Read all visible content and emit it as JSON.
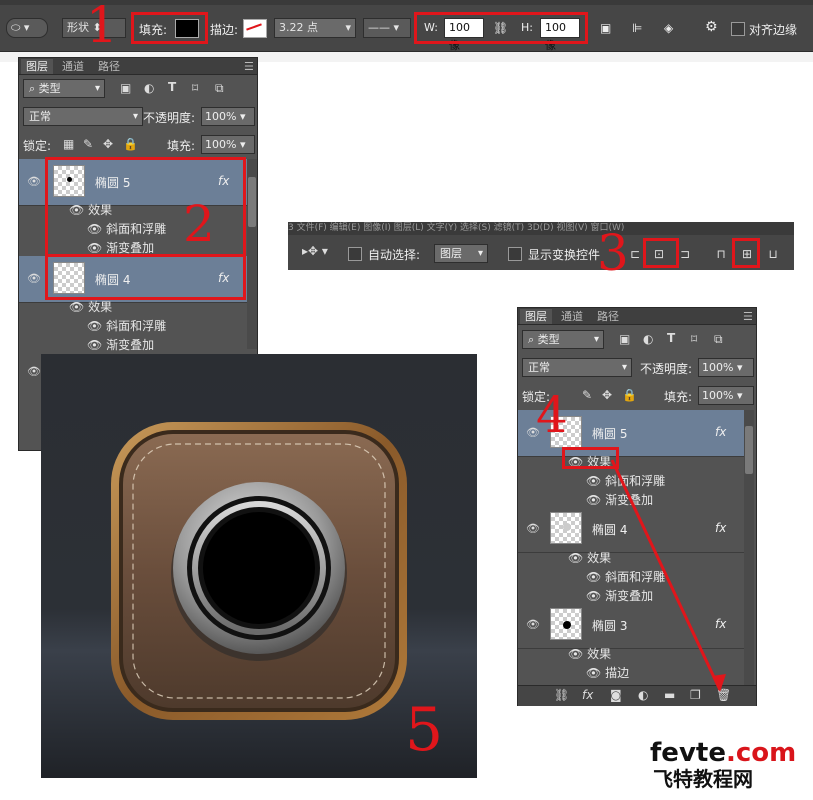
{
  "options_bar": {
    "shape_mode": "形状",
    "fill_label": "填充:",
    "stroke_label": "描边:",
    "stroke_width": "3.22 点",
    "w_label": "W:",
    "w_value": "100 像",
    "h_label": "H:",
    "h_value": "100 像",
    "align_edges_label": "对齐边缘"
  },
  "annotations": [
    "1",
    "2",
    "3",
    "4",
    "5"
  ],
  "panel_a": {
    "tabs": [
      "图层",
      "通道",
      "路径"
    ],
    "filter_kind": "类型",
    "blend_mode": "正常",
    "opacity_label": "不透明度:",
    "opacity_value": "100%",
    "lock_label": "锁定:",
    "fill_label": "填充:",
    "fill_value": "100%",
    "layers": [
      {
        "name": "椭圆 5",
        "effects_label": "效果",
        "effects": [
          "斜面和浮雕",
          "渐变叠加"
        ],
        "fx": "fx"
      },
      {
        "name": "椭圆 4",
        "effects_label": "效果",
        "effects": [
          "斜面和浮雕",
          "渐变叠加"
        ],
        "fx": "fx"
      }
    ]
  },
  "move_toolbar": {
    "auto_select_label": "自动选择:",
    "auto_select_value": "图层",
    "show_transform_label": "显示变换控件",
    "menu_fragment": "3 文件(F) 编辑(E) 图像(I) 图层(L) 文字(Y) 选择(S) 滤镜(T) 3D(D) 视图(V) 窗口(W)"
  },
  "panel_b": {
    "tabs": [
      "图层",
      "通道",
      "路径"
    ],
    "filter_kind": "类型",
    "blend_mode": "正常",
    "opacity_label": "不透明度:",
    "opacity_value": "100%",
    "lock_label": "锁定:",
    "fill_label": "填充:",
    "fill_value": "100%",
    "layers": [
      {
        "name": "椭圆 5",
        "effects_label": "效果",
        "effects": [
          "斜面和浮雕",
          "渐变叠加"
        ],
        "fx": "fx"
      },
      {
        "name": "椭圆 4",
        "effects_label": "效果",
        "effects": [
          "斜面和浮雕",
          "渐变叠加"
        ],
        "fx": "fx"
      },
      {
        "name": "椭圆 3",
        "effects_label": "效果",
        "effects": [
          "描边"
        ],
        "fx": "fx"
      }
    ]
  },
  "watermark": {
    "line1_a": "fevte",
    "line1_b": ".com",
    "line2": "飞特教程网"
  }
}
